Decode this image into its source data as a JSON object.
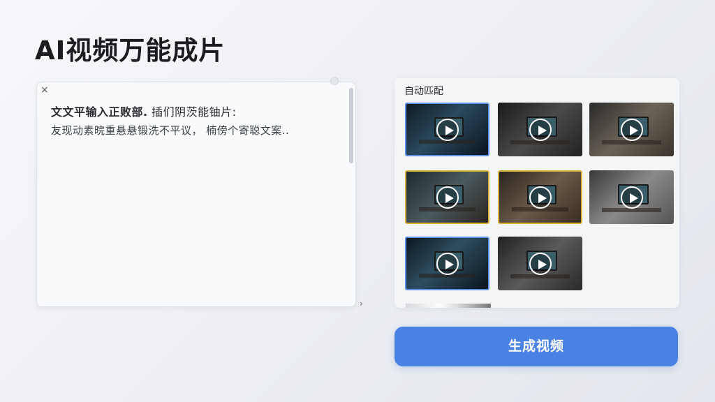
{
  "title": "AI视频万能成片",
  "text_panel": {
    "close_label": "×",
    "line1_bold": "文文平输入正败部.",
    "line1_rest": "  插们阴茨能铀片:",
    "line2": "友现动素晥重悬悬锻洗不平议， 楠傍个寄聪文案.."
  },
  "expand_arrow": "›",
  "match_panel": {
    "label": "自动匹配",
    "thumbnails": [
      {
        "name": "video-thumb-1",
        "border": "blue",
        "bg": "linear-gradient(135deg,#0e1a24,#2a4a5e 45%,#0b1520)"
      },
      {
        "name": "video-thumb-2",
        "border": "none",
        "bg": "linear-gradient(135deg,#1a1a1a,#4a4a4a 50%,#222)"
      },
      {
        "name": "video-thumb-3",
        "border": "none",
        "bg": "linear-gradient(135deg,#2a2a2a,#6b6358 50%,#3a342c)"
      },
      {
        "name": "video-thumb-4",
        "border": "gold",
        "bg": "linear-gradient(135deg,#1e2a30,#4b5a5e 50%,#2a2520)"
      },
      {
        "name": "video-thumb-5",
        "border": "gold",
        "bg": "linear-gradient(135deg,#2a2420,#6a5a48 50%,#3a2e22)"
      },
      {
        "name": "video-thumb-6",
        "border": "none",
        "bg": "linear-gradient(135deg,#3a3a3a,#8a8a8a 50%,#555)"
      },
      {
        "name": "video-thumb-7",
        "border": "blue",
        "bg": "linear-gradient(135deg,#0c1822,#2e4e60 45%,#0a141c)"
      },
      {
        "name": "video-thumb-8",
        "border": "none",
        "bg": "linear-gradient(135deg,#222,#5a5a5a 50%,#2a2a2a)"
      }
    ]
  },
  "generate_button": "生成视频",
  "colors": {
    "accent": "#4a82e3",
    "thumb_blue_border": "#5a8ee8",
    "thumb_gold_border": "#d8b23a"
  }
}
